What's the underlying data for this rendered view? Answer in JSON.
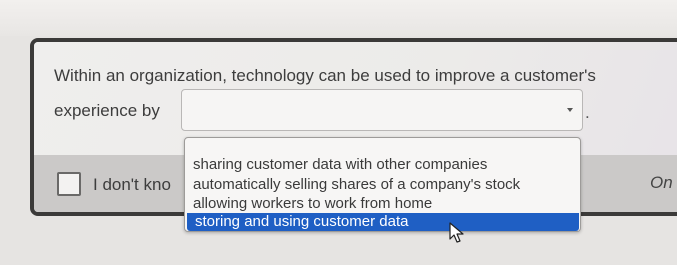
{
  "question": {
    "line1": "Within an organization, technology can be used to improve a customer's",
    "line2_prefix": "experience by",
    "trailing_period": "."
  },
  "select": {
    "current_value": "",
    "options": [
      "sharing customer data with other companies",
      "automatically selling shares of a company's stock",
      "allowing workers to work from home",
      "storing and using customer data"
    ],
    "highlighted_index": 3
  },
  "footer": {
    "idk_label": "I don't kno",
    "right_label": "On"
  },
  "icons": {
    "caret": "chevron-down-icon",
    "cursor": "mouse-pointer-icon"
  },
  "colors": {
    "highlight": "#1f5fc4",
    "card_border": "#3b3a39"
  }
}
